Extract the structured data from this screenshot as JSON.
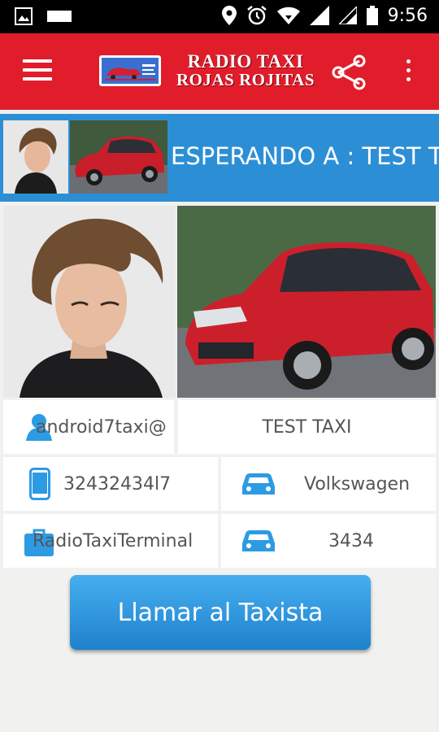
{
  "status_bar": {
    "time": "9:56"
  },
  "toolbar": {
    "title_line1": "RADIO TAXI",
    "title_line2": "ROJAS ROJITAS"
  },
  "banner": {
    "text": "ESPERANDO A : TEST TAXI"
  },
  "driver": {
    "email": "android7taxi@",
    "name": "TEST TAXI",
    "phone": "32432434l7",
    "car_brand": "Volkswagen",
    "company": "RadioTaxiTerminal",
    "car_number": "3434"
  },
  "actions": {
    "call_label": "Llamar al Taxista"
  },
  "colors": {
    "toolbar": "#e11d2b",
    "banner": "#2c8fd6",
    "icon": "#2c9be4",
    "button": "#2a8fd8"
  }
}
